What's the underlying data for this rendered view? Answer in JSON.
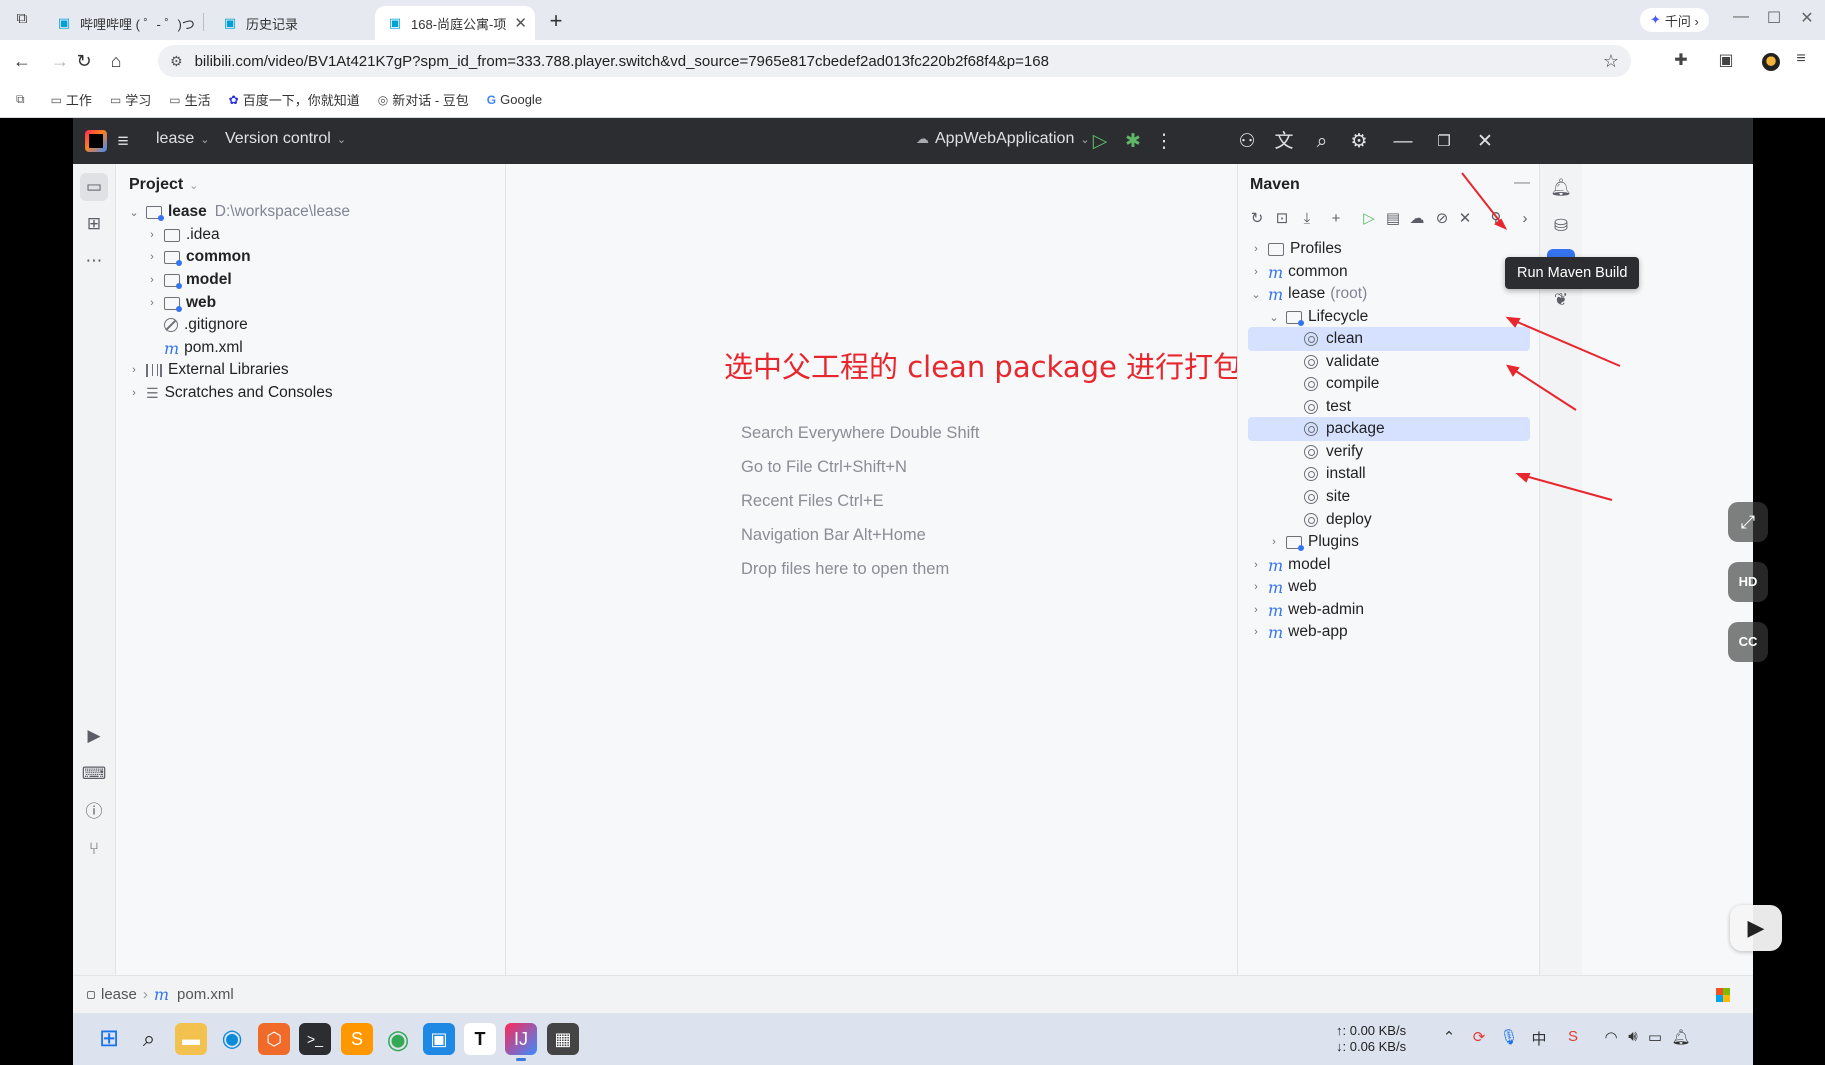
{
  "browser": {
    "tabs": [
      {
        "title": "哔哩哔哩 ( ゜- ゜)つロ",
        "active": false
      },
      {
        "title": "历史记录",
        "active": false
      },
      {
        "title": "168-尚庭公寓-项",
        "active": true
      }
    ],
    "new_tab": "+",
    "qianwen_label": "千问 ›",
    "url": "bilibili.com/video/BV1At421K7gP?spm_id_from=333.788.player.switch&vd_source=7965e817cbedef2ad013fc220b2f68f4&p=168",
    "bookmarks": [
      "工作",
      "学习",
      "生活",
      "百度一下，你就知道",
      "新对话 - 豆包",
      "Google"
    ]
  },
  "ide": {
    "project_name": "lease",
    "version_control": "Version control",
    "run_config": "AppWebApplication",
    "project_panel": {
      "title": "Project",
      "root": {
        "name": "lease",
        "path": "D:\\workspace\\lease"
      },
      "children": [
        ".idea",
        "common",
        "model",
        "web",
        ".gitignore",
        "pom.xml"
      ],
      "external_libraries": "External Libraries",
      "scratches": "Scratches and Consoles"
    },
    "editor_hints": [
      "Search Everywhere Double Shift",
      "Go to File Ctrl+Shift+N",
      "Recent Files Ctrl+E",
      "Navigation Bar Alt+Home",
      "Drop files here to open them"
    ],
    "annotation": "选中父工程的 clean package 进行打包",
    "maven": {
      "title": "Maven",
      "tooltip": "Run Maven Build",
      "profiles": "Profiles",
      "modules_before": [
        "common"
      ],
      "root": {
        "name": "lease",
        "suffix": "(root)"
      },
      "lifecycle": "Lifecycle",
      "phases": [
        "clean",
        "validate",
        "compile",
        "test",
        "package",
        "verify",
        "install",
        "site",
        "deploy"
      ],
      "selected_phases": [
        "clean",
        "package"
      ],
      "plugins": "Plugins",
      "modules_after": [
        "model",
        "web",
        "web-admin",
        "web-app"
      ]
    },
    "breadcrumb": [
      "lease",
      "pom.xml"
    ]
  },
  "taskbar": {
    "upload": "↑: 0.00 KB/s",
    "download": "↓: 0.06 KB/s"
  },
  "colors": {
    "annotation_red": "#e8262d",
    "ide_dark": "#2b2d30",
    "selection": "#d5e1ff",
    "accent_blue": "#3574f0"
  }
}
